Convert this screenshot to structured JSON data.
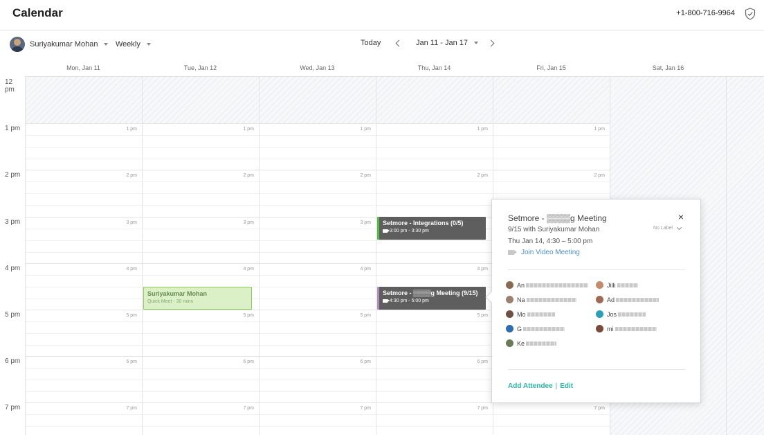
{
  "header": {
    "title": "Calendar",
    "phone": "+1-800-716-9964"
  },
  "toolbar": {
    "user_name": "Suriyakumar Mohan",
    "view": "Weekly",
    "today": "Today",
    "range": "Jan 11 - Jan 17"
  },
  "days": [
    "Mon, Jan 11",
    "Tue, Jan 12",
    "Wed, Jan 13",
    "Thu, Jan 14",
    "Fri, Jan 15",
    "Sat, Jan 16"
  ],
  "hours": [
    "12 pm",
    "1 pm",
    "2 pm",
    "3 pm",
    "4 pm",
    "5 pm",
    "6 pm",
    "7 pm"
  ],
  "events": {
    "integrations": {
      "title": "Setmore - Integrations (0/5)",
      "time": "3:00 pm - 3:30 pm"
    },
    "meeting": {
      "title": "Setmore - ▒▒▒▒g Meeting (9/15)",
      "time": "4:30 pm - 5:00 pm"
    },
    "quick_meet": {
      "title": "Suriyakumar Mohan",
      "subtitle": "Quick Meet - 30 mins"
    }
  },
  "popup": {
    "title": "Setmore - ▒▒▒▒g Meeting",
    "line1": "9/15 with Suriyakumar Mohan",
    "line2": "Thu Jan 14, 4:30 – 5:00 pm",
    "join": "Join Video Meeting",
    "label": "No Label",
    "close": "×",
    "attendees": [
      {
        "name": "An",
        "color": "#8a6a52"
      },
      {
        "name": "Jilli",
        "color": "#c58a6a"
      },
      {
        "name": "Na",
        "color": "#9a8070"
      },
      {
        "name": "Ad",
        "color": "#a06a55"
      },
      {
        "name": "Mo",
        "color": "#6b5242"
      },
      {
        "name": "Jos",
        "color": "#2a9fb8"
      },
      {
        "name": "G",
        "color": "#2e6db0"
      },
      {
        "name": "mi",
        "color": "#7a4a3a"
      },
      {
        "name": "Ke",
        "color": "#6a7a5a"
      }
    ],
    "add_attendee": "Add Attendee",
    "separator": "|",
    "edit": "Edit"
  }
}
